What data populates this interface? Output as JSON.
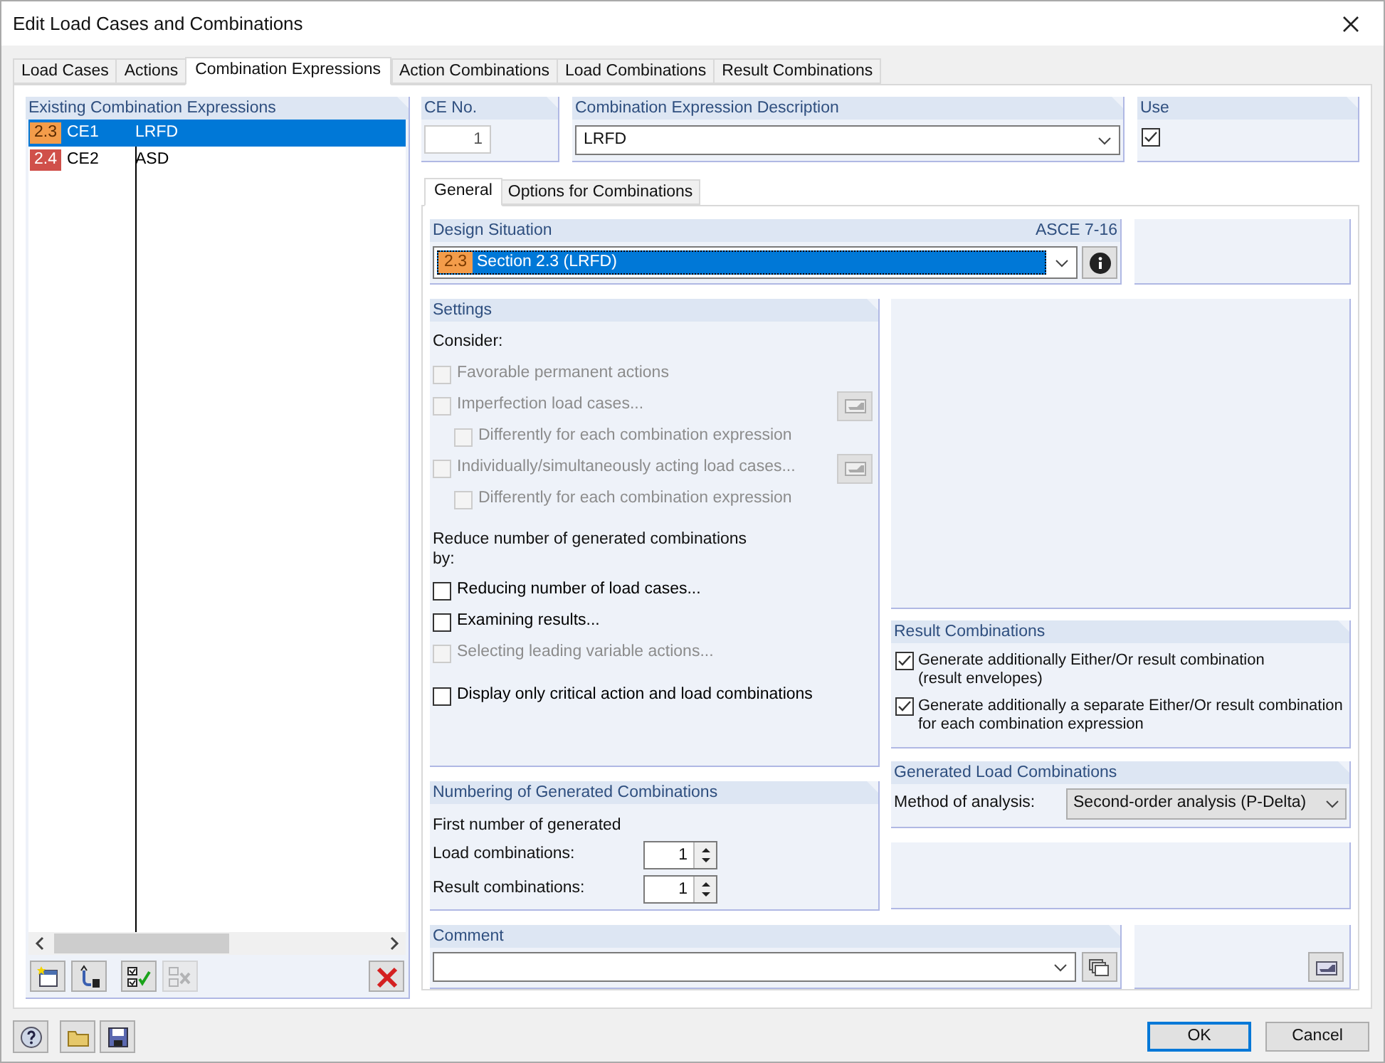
{
  "window": {
    "title": "Edit Load Cases and Combinations"
  },
  "tabs": [
    {
      "label": "Load Cases",
      "selected": false
    },
    {
      "label": "Actions",
      "selected": false
    },
    {
      "label": "Combination Expressions",
      "selected": true
    },
    {
      "label": "Action Combinations",
      "selected": false
    },
    {
      "label": "Load Combinations",
      "selected": false
    },
    {
      "label": "Result Combinations",
      "selected": false
    }
  ],
  "expressions": {
    "title": "Existing Combination Expressions",
    "rows": [
      {
        "code": "2.3",
        "color": "#f39c4a",
        "name": "CE1",
        "description": "LRFD",
        "selected": true
      },
      {
        "code": "2.4",
        "color": "#d0504a",
        "name": "CE2",
        "description": "ASD",
        "selected": false
      }
    ]
  },
  "list_toolbar": [
    {
      "kind": "new",
      "disabled": false
    },
    {
      "kind": "rename",
      "disabled": false
    },
    {
      "kind": "check_all",
      "disabled": false
    },
    {
      "kind": "uncheck_all",
      "disabled": true
    },
    {
      "kind": "delete",
      "disabled": false
    }
  ],
  "ce_no": {
    "label": "CE No.",
    "value": "1"
  },
  "description": {
    "label": "Combination Expression Description",
    "value": "LRFD"
  },
  "use": {
    "label": "Use",
    "checked": true
  },
  "inner_tabs": [
    {
      "label": "General",
      "selected": true
    },
    {
      "label": "Options for Combinations",
      "selected": false
    }
  ],
  "design_situation": {
    "label": "Design Situation",
    "standard": "ASCE 7-16",
    "code": "2.3",
    "color": "#f39c4a",
    "value": "Section 2.3 (LRFD)"
  },
  "settings": {
    "title": "Settings",
    "consider_label": "Consider:",
    "consider_items": [
      {
        "label": "Favorable permanent actions",
        "checked": false,
        "disabled": true,
        "kind": "plain"
      },
      {
        "label": "Imperfection load cases...",
        "checked": false,
        "disabled": true,
        "kind": "with_button",
        "children": [
          {
            "label": "Differently for each combination expression",
            "checked": false,
            "disabled": true
          }
        ]
      },
      {
        "label": "Individually/simultaneously acting load cases...",
        "checked": false,
        "disabled": true,
        "kind": "with_button",
        "children": [
          {
            "label": "Differently for each combination expression",
            "checked": false,
            "disabled": true
          }
        ]
      }
    ],
    "reduce_label": "Reduce number of generated combinations\nby:",
    "reduce_items": [
      {
        "label": "Reducing number of load cases...",
        "checked": false,
        "disabled": false
      },
      {
        "label": "Examining results...",
        "checked": false,
        "disabled": false
      },
      {
        "label": "Selecting leading variable actions...",
        "checked": false,
        "disabled": true
      }
    ],
    "critical": {
      "label": "Display only critical action and load combinations",
      "checked": false
    }
  },
  "result_combinations": {
    "title": "Result Combinations",
    "items": [
      {
        "label": "Generate additionally Either/Or result combination\n(result envelopes)",
        "checked": true
      },
      {
        "label": "Generate additionally a separate Either/Or result combination\nfor each combination expression",
        "checked": true
      }
    ]
  },
  "generated_load_combinations": {
    "title": "Generated Load Combinations",
    "method_label": "Method of analysis:",
    "method_value": "Second-order analysis (P-Delta)"
  },
  "numbering": {
    "title": "Numbering of Generated Combinations",
    "intro": "First number of generated",
    "rows": [
      {
        "label": "Load combinations:",
        "value": "1"
      },
      {
        "label": "Result combinations:",
        "value": "1"
      }
    ]
  },
  "comment": {
    "label": "Comment"
  },
  "buttons": [
    {
      "label": "OK",
      "default": true
    },
    {
      "label": "Cancel",
      "default": false
    }
  ]
}
